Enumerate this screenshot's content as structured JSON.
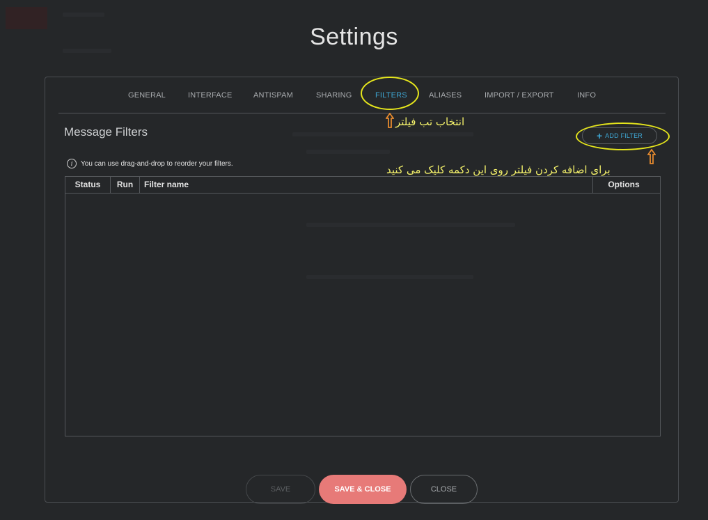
{
  "title": "Settings",
  "tabs": [
    {
      "label": "GENERAL"
    },
    {
      "label": "INTERFACE"
    },
    {
      "label": "ANTISPAM"
    },
    {
      "label": "SHARING"
    },
    {
      "label": "FILTERS",
      "active": true
    },
    {
      "label": "ALIASES"
    },
    {
      "label": "IMPORT / EXPORT"
    },
    {
      "label": "INFO"
    }
  ],
  "section": {
    "title": "Message Filters",
    "hint": "You can use drag-and-drop to reorder your filters.",
    "add_filter_label": "ADD FILTER"
  },
  "table": {
    "columns": [
      "Status",
      "Run",
      "Filter name",
      "Options"
    ],
    "rows": []
  },
  "buttons": {
    "save": "SAVE",
    "save_close": "SAVE & CLOSE",
    "close": "CLOSE"
  },
  "annotations": {
    "filters_tab_note": "انتخاب تب فیلتر",
    "add_filter_note": "برای اضافه کردن فیلتر روی این دکمه کلیک می کنید"
  },
  "colors": {
    "accent": "#3ea6d2",
    "primary_button": "#e77a78",
    "annotation": "#e6e61c",
    "arrow": "#e68a2e",
    "background": "#2b2d2f"
  },
  "icons": [
    "info-icon",
    "plus-icon",
    "up-arrow-icon"
  ]
}
